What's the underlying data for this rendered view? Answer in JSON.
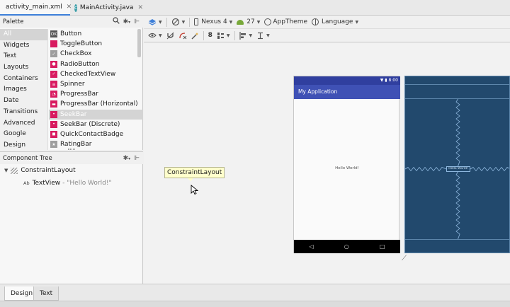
{
  "file_tabs": [
    {
      "label": "activity_main.xml",
      "icon": "xml-file-icon",
      "active": true
    },
    {
      "label": "MainActivity.java",
      "icon": "java-class-icon",
      "active": false
    }
  ],
  "palette": {
    "title": "Palette",
    "categories": [
      "All",
      "Widgets",
      "Text",
      "Layouts",
      "Containers",
      "Images",
      "Date",
      "Transitions",
      "Advanced",
      "Google",
      "Design"
    ],
    "selected_category": "All",
    "widgets": [
      {
        "label": "Button",
        "icon": "button-icon",
        "color": "#555555",
        "glyph": "OK"
      },
      {
        "label": "ToggleButton",
        "icon": "toggle-button-icon",
        "color": "#d81b60",
        "glyph": ""
      },
      {
        "label": "CheckBox",
        "icon": "checkbox-icon",
        "color": "#9e9e9e",
        "glyph": "✓"
      },
      {
        "label": "RadioButton",
        "icon": "radio-button-icon",
        "color": "#d81b60",
        "glyph": "●"
      },
      {
        "label": "CheckedTextView",
        "icon": "checked-text-view-icon",
        "color": "#d81b60",
        "glyph": "✓"
      },
      {
        "label": "Spinner",
        "icon": "spinner-icon",
        "color": "#d81b60",
        "glyph": "≡"
      },
      {
        "label": "ProgressBar",
        "icon": "progress-bar-icon",
        "color": "#d81b60",
        "glyph": "◔"
      },
      {
        "label": "ProgressBar (Horizontal)",
        "icon": "progress-bar-horizontal-icon",
        "color": "#d81b60",
        "glyph": "▬"
      },
      {
        "label": "SeekBar",
        "icon": "seekbar-icon",
        "color": "#d81b60",
        "glyph": "•"
      },
      {
        "label": "SeekBar (Discrete)",
        "icon": "seekbar-discrete-icon",
        "color": "#d81b60",
        "glyph": "•"
      },
      {
        "label": "QuickContactBadge",
        "icon": "quick-contact-badge-icon",
        "color": "#d81b60",
        "glyph": "◼"
      },
      {
        "label": "RatingBar",
        "icon": "rating-bar-icon",
        "color": "#9e9e9e",
        "glyph": "★"
      }
    ],
    "selected_widget": "SeekBar"
  },
  "component_tree": {
    "title": "Component Tree",
    "root": "ConstraintLayout",
    "child_icon_text": "Ab",
    "child": "TextView",
    "child_detail": "- \"Hello World!\""
  },
  "toolbar1": {
    "device": "Nexus 4",
    "api": "27",
    "theme": "AppTheme",
    "language": "Language"
  },
  "toolbar2": {
    "margin": "8"
  },
  "canvas": {
    "tooltip": "ConstraintLayout",
    "phone": {
      "status_time": "8:00",
      "app_title": "My Application",
      "content_text": "Hello World!",
      "nav_back": "◁",
      "nav_home": "○",
      "nav_recent": "□"
    },
    "blueprint_text": "Hello World!"
  },
  "bottom_tabs": [
    {
      "label": "Design",
      "active": true
    },
    {
      "label": "Text",
      "active": false
    }
  ],
  "colors": {
    "app_bar": "#3f51b5",
    "status_bar": "#303f9f",
    "blueprint": "#22496d",
    "selection": "#d4d4d4",
    "accent": "#d81b60"
  }
}
